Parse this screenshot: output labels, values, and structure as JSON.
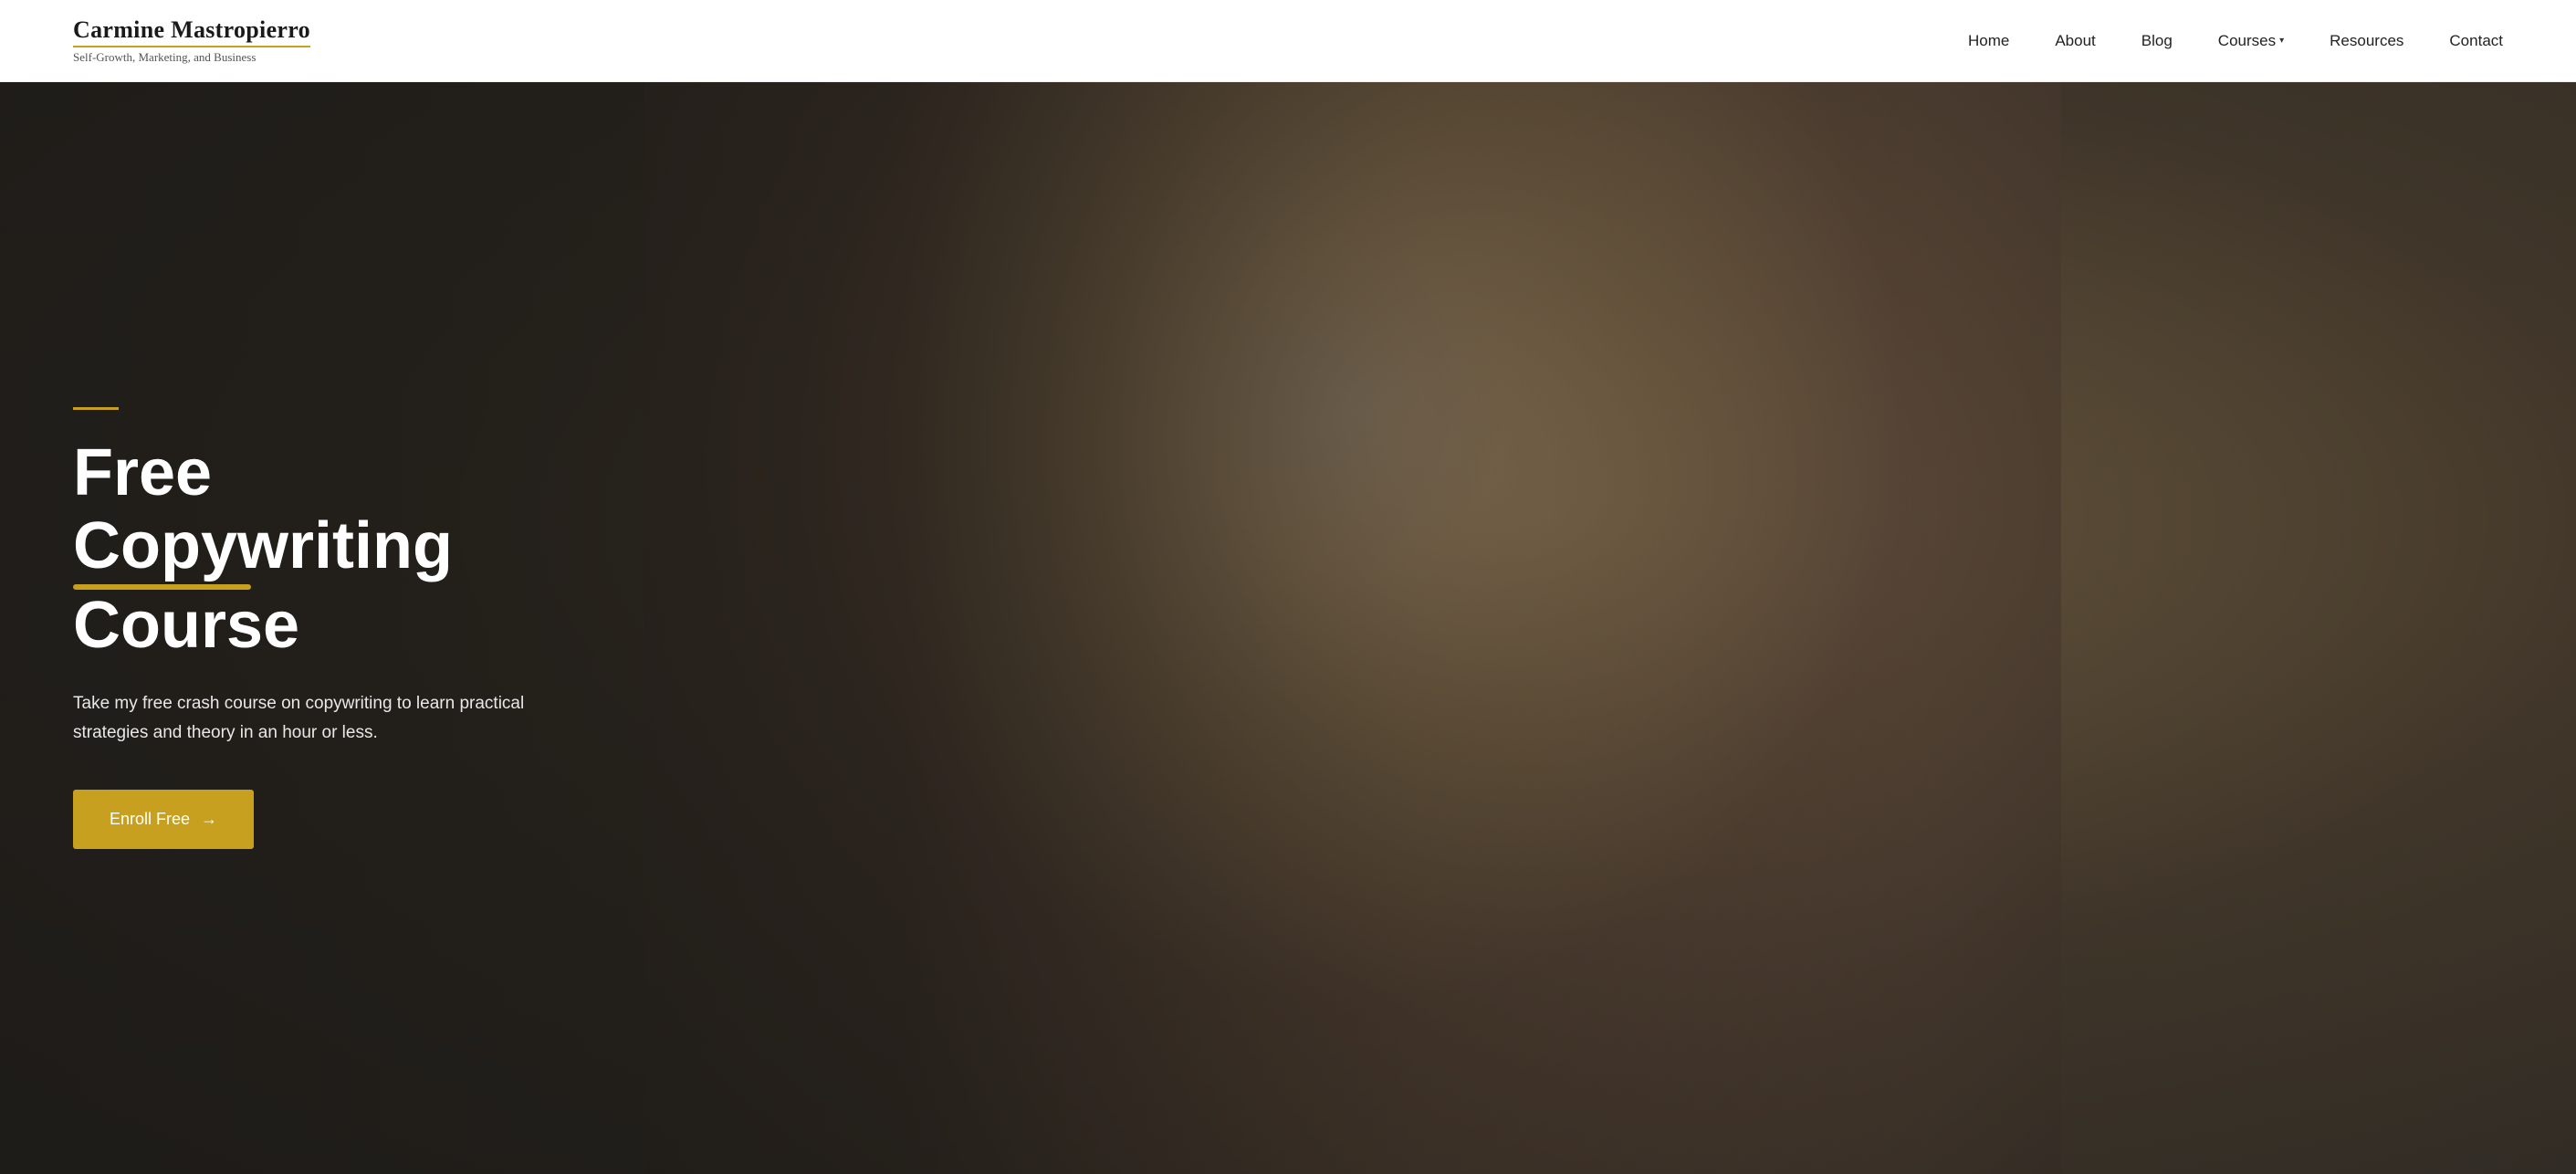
{
  "header": {
    "logo": {
      "name": "Carmine Mastropierro",
      "tagline": "Self-Growth, Marketing, and Business"
    },
    "nav": {
      "items": [
        {
          "id": "home",
          "label": "Home",
          "has_dropdown": false
        },
        {
          "id": "about",
          "label": "About",
          "has_dropdown": false
        },
        {
          "id": "blog",
          "label": "Blog",
          "has_dropdown": false
        },
        {
          "id": "courses",
          "label": "Courses",
          "has_dropdown": true
        },
        {
          "id": "resources",
          "label": "Resources",
          "has_dropdown": false
        },
        {
          "id": "contact",
          "label": "Contact",
          "has_dropdown": false
        }
      ]
    }
  },
  "hero": {
    "accent_line": "",
    "title_part1": "Free Copywriting",
    "title_underline_word": "Free Copywriting",
    "title_part2": "Course",
    "description": "Take my free crash course on copywriting to learn practical strategies and theory in an hour or less.",
    "cta_button": "Enroll Free →",
    "cta_label": "Enroll Free",
    "cta_arrow": "→"
  },
  "colors": {
    "accent": "#c8a020",
    "dark_overlay": "rgba(30,28,25,0.88)",
    "text_light": "#ffffff",
    "text_muted": "#e8e8e8"
  }
}
